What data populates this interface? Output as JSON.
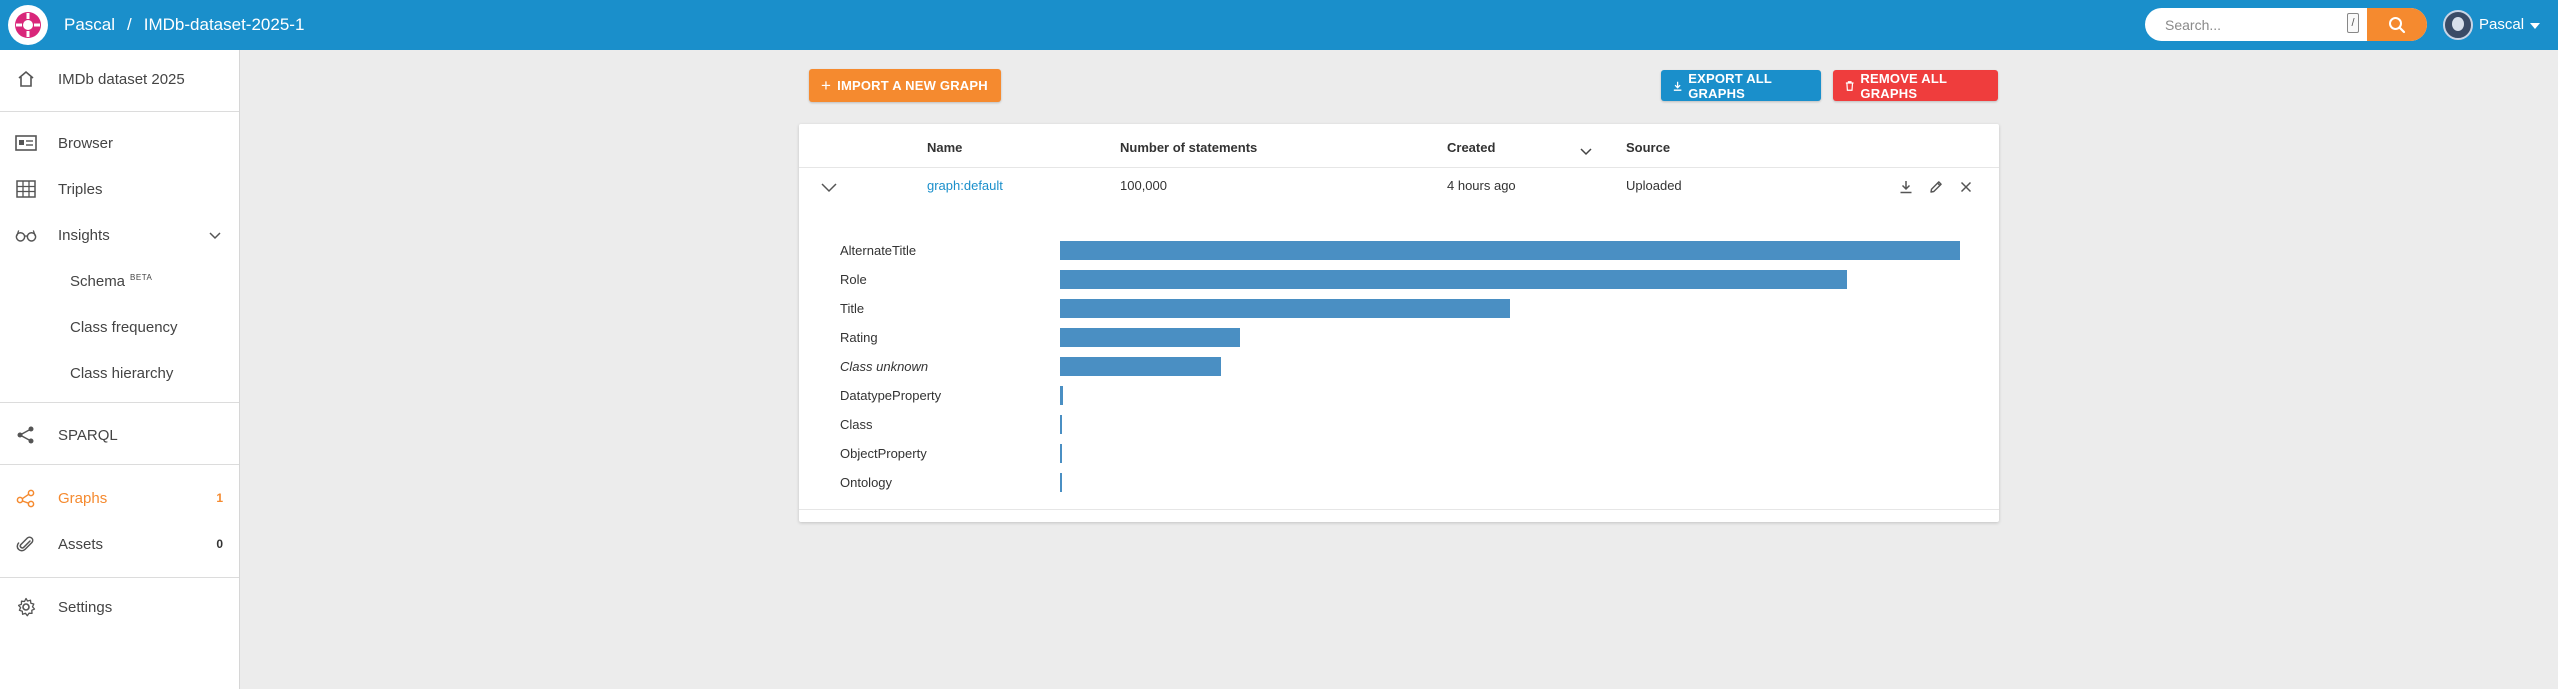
{
  "header": {
    "account": "Pascal",
    "separator": "/",
    "dataset": "IMDb-dataset-2025-1",
    "search": {
      "placeholder": "Search...",
      "shortcut": "/"
    },
    "user": {
      "name": "Pascal"
    }
  },
  "sidebar": {
    "dataset_title": "IMDb dataset 2025",
    "items": [
      {
        "label": "Browser",
        "icon": "browser-icon"
      },
      {
        "label": "Triples",
        "icon": "table-icon"
      },
      {
        "label": "Insights",
        "icon": "glasses-icon"
      },
      {
        "label": "Schema",
        "badge": "BETA"
      },
      {
        "label": "Class frequency"
      },
      {
        "label": "Class hierarchy"
      },
      {
        "label": "SPARQL",
        "icon": "share-icon"
      },
      {
        "label": "Graphs",
        "icon": "graphs-icon",
        "count": "1",
        "active": true
      },
      {
        "label": "Assets",
        "icon": "paperclip-icon",
        "count": "0"
      },
      {
        "label": "Settings",
        "icon": "gear-icon"
      }
    ]
  },
  "actions": {
    "import": "IMPORT A NEW GRAPH",
    "export": "EXPORT ALL GRAPHS",
    "remove": "REMOVE ALL GRAPHS"
  },
  "table": {
    "columns": [
      "Name",
      "Number of statements",
      "Created",
      "Source"
    ],
    "row": {
      "name": "graph:default",
      "statements": "100,000",
      "created": "4 hours ago",
      "source": "Uploaded"
    }
  },
  "colors": {
    "primary": "#1a8fcb",
    "accent": "#f58a2f",
    "danger": "#ef3d3d",
    "bar": "#4a8fc3"
  },
  "chart_data": {
    "type": "bar",
    "orientation": "horizontal",
    "categories": [
      "AlternateTitle",
      "Role",
      "Title",
      "Rating",
      "Class unknown",
      "DatatypeProperty",
      "Class",
      "ObjectProperty",
      "Ontology"
    ],
    "values": [
      100,
      87.4,
      50,
      20,
      17.9,
      0.35,
      0.12,
      0.1,
      0.1
    ],
    "italic_categories": [
      "Class unknown"
    ],
    "xlim": [
      0,
      100
    ]
  }
}
